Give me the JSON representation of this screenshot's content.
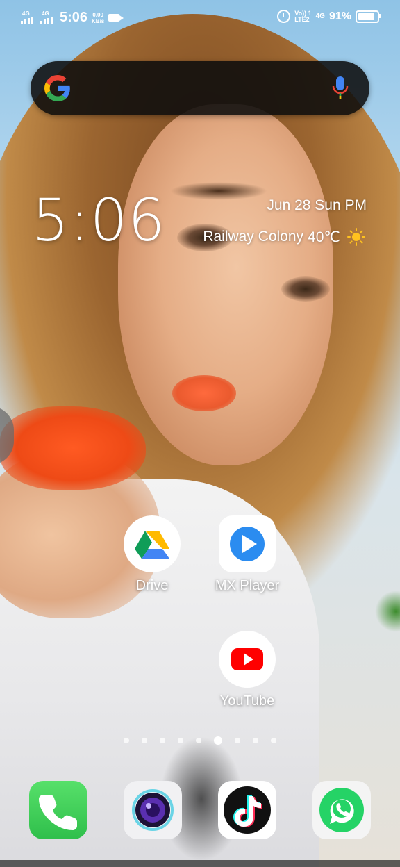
{
  "status_bar": {
    "sim1_network": "4G",
    "sim2_network": "4G",
    "time": "5:06",
    "speed_value": "0.00",
    "speed_unit": "KB/s",
    "volte_label": "Vo)) 1",
    "lte_label": "LTE2",
    "net_label": "4G",
    "battery_percent": "91%",
    "battery_level": 0.91
  },
  "search_bar": {
    "logo": "google-g-icon",
    "mic": "mic-icon"
  },
  "clock_widget": {
    "time": "5:06",
    "date": "Jun 28 Sun PM",
    "location": "Railway Colony",
    "temperature": "40℃",
    "weather_icon": "sun-icon"
  },
  "apps": [
    {
      "label": "Drive",
      "icon": "google-drive-icon"
    },
    {
      "label": "MX Player",
      "icon": "mx-player-icon"
    },
    {
      "label": "YouTube",
      "icon": "youtube-icon"
    }
  ],
  "page_indicator": {
    "count": 9,
    "active_index": 5
  },
  "dock": [
    {
      "name": "Phone",
      "icon": "phone-icon"
    },
    {
      "name": "Camera",
      "icon": "camera-icon"
    },
    {
      "name": "TikTok",
      "icon": "tiktok-icon"
    },
    {
      "name": "WhatsApp",
      "icon": "whatsapp-icon"
    }
  ],
  "colors": {
    "phone_green": "#3fd25a",
    "whatsapp_green": "#25d366",
    "youtube_red": "#ff0000",
    "mx_blue": "#2b8cf0"
  }
}
